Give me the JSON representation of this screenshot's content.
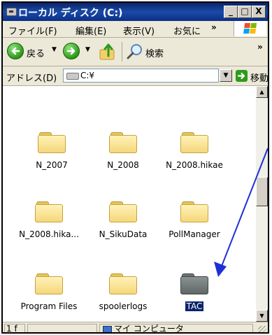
{
  "window": {
    "title": "ローカル ディスク (C:)",
    "controls": {
      "minimize": "_",
      "maximize": "□",
      "close": "X"
    }
  },
  "menu": {
    "items": [
      {
        "label": "ファイル(F)"
      },
      {
        "label": "編集(E)"
      },
      {
        "label": "表示(V)"
      },
      {
        "label": "お気に"
      }
    ],
    "more": "»"
  },
  "toolbar": {
    "back_label": "戻る",
    "search_label": "検索",
    "more": "»"
  },
  "address": {
    "label": "アドレス(D)",
    "value": "C:¥",
    "go_label": "移動"
  },
  "content": {
    "items": [
      {
        "label": "N_2007",
        "type": "folder"
      },
      {
        "label": "N_2008",
        "type": "folder"
      },
      {
        "label": "N_2008.hikae",
        "type": "folder"
      },
      {
        "label": "N_2008.hika...",
        "type": "folder"
      },
      {
        "label": "N_SikuData",
        "type": "folder"
      },
      {
        "label": "PollManager",
        "type": "folder"
      },
      {
        "label": "Program Files",
        "type": "folder"
      },
      {
        "label": "spoolerlogs",
        "type": "folder"
      },
      {
        "label": "TAC",
        "type": "folder-hidden",
        "selected": true
      }
    ]
  },
  "status": {
    "count": "1 f",
    "location": "マイ コンピュータ"
  },
  "colors": {
    "titlebar": "#0a246a",
    "selection": "#0a246a",
    "annotation_arrow": "#1f2fd6"
  }
}
